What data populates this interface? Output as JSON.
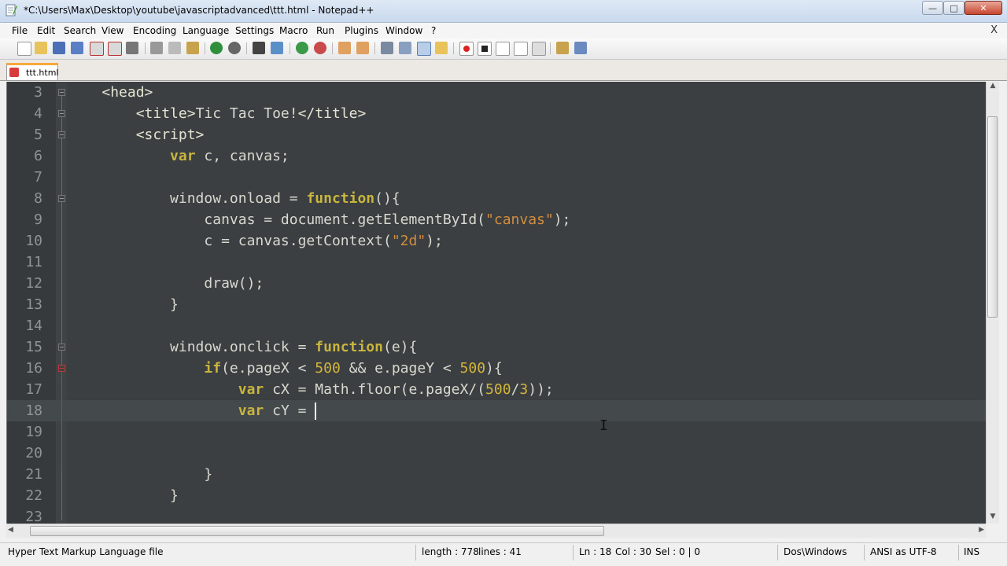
{
  "window": {
    "title": "*C:\\Users\\Max\\Desktop\\youtube\\javascriptadvanced\\ttt.html - Notepad++",
    "min_label": "—",
    "max_label": "□",
    "close_label": "✕"
  },
  "menu": {
    "items": [
      "File",
      "Edit",
      "Search",
      "View",
      "Encoding",
      "Language",
      "Settings",
      "Macro",
      "Run",
      "Plugins",
      "Window",
      "?"
    ],
    "close_label": "X"
  },
  "tabs": [
    {
      "label": "ttt.html"
    }
  ],
  "editor": {
    "line_numbers": [
      "3",
      "4",
      "5",
      "6",
      "7",
      "8",
      "9",
      "10",
      "11",
      "12",
      "13",
      "14",
      "15",
      "16",
      "17",
      "18",
      "19",
      "20",
      "21",
      "22",
      "23"
    ],
    "lines": {
      "l3_tag": "<head>",
      "l4_open": "<title>",
      "l4_text": "Tic Tac Toe!",
      "l4_close": "</title>",
      "l5_tag": "<script>",
      "l6_kw": "var",
      "l6_rest": " c, canvas;",
      "l8_a": "window.onload = ",
      "l8_kw": "function",
      "l8_b": "(){",
      "l9_a": "canvas = document.getElementById(",
      "l9_str": "\"canvas\"",
      "l9_b": ");",
      "l10_a": "c = canvas.getContext(",
      "l10_str": "\"2d\"",
      "l10_b": ");",
      "l12": "draw();",
      "l13": "}",
      "l15_a": "window.onclick = ",
      "l15_kw": "function",
      "l15_b": "(e){",
      "l16_kw": "if",
      "l16_a": "(e.pageX < ",
      "l16_n1": "500",
      "l16_b": " && e.pageY < ",
      "l16_n2": "500",
      "l16_c": "){",
      "l17_kw": "var",
      "l17_a": " cX = Math.floor(e.pageX/(",
      "l17_n1": "500",
      "l17_b": "/",
      "l17_n2": "3",
      "l17_c": "));",
      "l18_kw": "var",
      "l18_a": " cY = ",
      "l21": "}",
      "l22": "}"
    }
  },
  "status": {
    "file_type": "Hyper Text Markup Language file",
    "length": "length : 778",
    "lines": "lines : 41",
    "ln": "Ln : 18",
    "col": "Col : 30",
    "sel": "Sel : 0 | 0",
    "eol": "Dos\\Windows",
    "encoding": "ANSI as UTF-8",
    "mode": "INS"
  },
  "scrollbars": {
    "up": "▲",
    "down": "▼",
    "left": "◀",
    "right": "▶"
  },
  "colors": {
    "editor_bg": "#3b3f42",
    "keyword": "#c9b43e",
    "string": "#d38d3f",
    "tab_accent": "#f7a93c"
  }
}
